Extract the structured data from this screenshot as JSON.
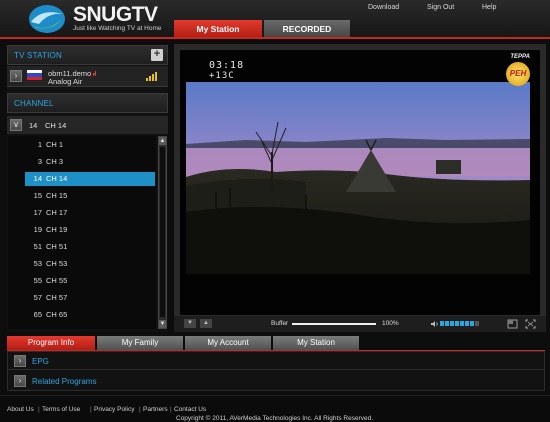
{
  "header": {
    "brand": "SNUGTV",
    "tagline": "Just like Watching TV at Home",
    "links": [
      "Download",
      "Sign Out",
      "Help"
    ],
    "tabs": [
      "My Station",
      "RECORDED"
    ]
  },
  "station_panel": {
    "title": "TV STATION",
    "add_label": "+",
    "station_name": "obm11.demo -",
    "station_type": "Analog Air"
  },
  "channel_panel": {
    "title": "CHANNEL",
    "current": {
      "num": "14",
      "name": "CH 14"
    },
    "items": [
      {
        "num": "1",
        "name": "CH 1"
      },
      {
        "num": "3",
        "name": "CH 3"
      },
      {
        "num": "14",
        "name": "CH 14"
      },
      {
        "num": "15",
        "name": "CH 15"
      },
      {
        "num": "17",
        "name": "CH 17"
      },
      {
        "num": "19",
        "name": "CH 19"
      },
      {
        "num": "51",
        "name": "CH 51"
      },
      {
        "num": "53",
        "name": "CH 53"
      },
      {
        "num": "55",
        "name": "CH 55"
      },
      {
        "num": "57",
        "name": "CH 57"
      },
      {
        "num": "65",
        "name": "CH 65"
      }
    ],
    "selected_index": 2
  },
  "video": {
    "osd_time": "03:18",
    "osd_temp": "+13C",
    "osd_logo_top": "ТЕРРА",
    "osd_logo": "РЕН"
  },
  "controls": {
    "buffer_label": "Buffer",
    "buffer_value": "100%",
    "buffer_level": 1.0
  },
  "bottom_tabs": [
    "Program Info",
    "My Family",
    "My Account",
    "My Station"
  ],
  "bottom_rows": [
    "EPG",
    "Related Programs"
  ],
  "footer": {
    "links": [
      "About Us",
      "Terms of Use",
      "Privacy Policy",
      "Partners",
      "Contact Us"
    ],
    "copyright": "Copyright © 2011, AVerMedia Technologies Inc. All Rights Reserved."
  },
  "colors": {
    "accent_red": "#c22a1f",
    "accent_blue": "#2aa6e0",
    "selected_row": "#1f8fc7"
  }
}
